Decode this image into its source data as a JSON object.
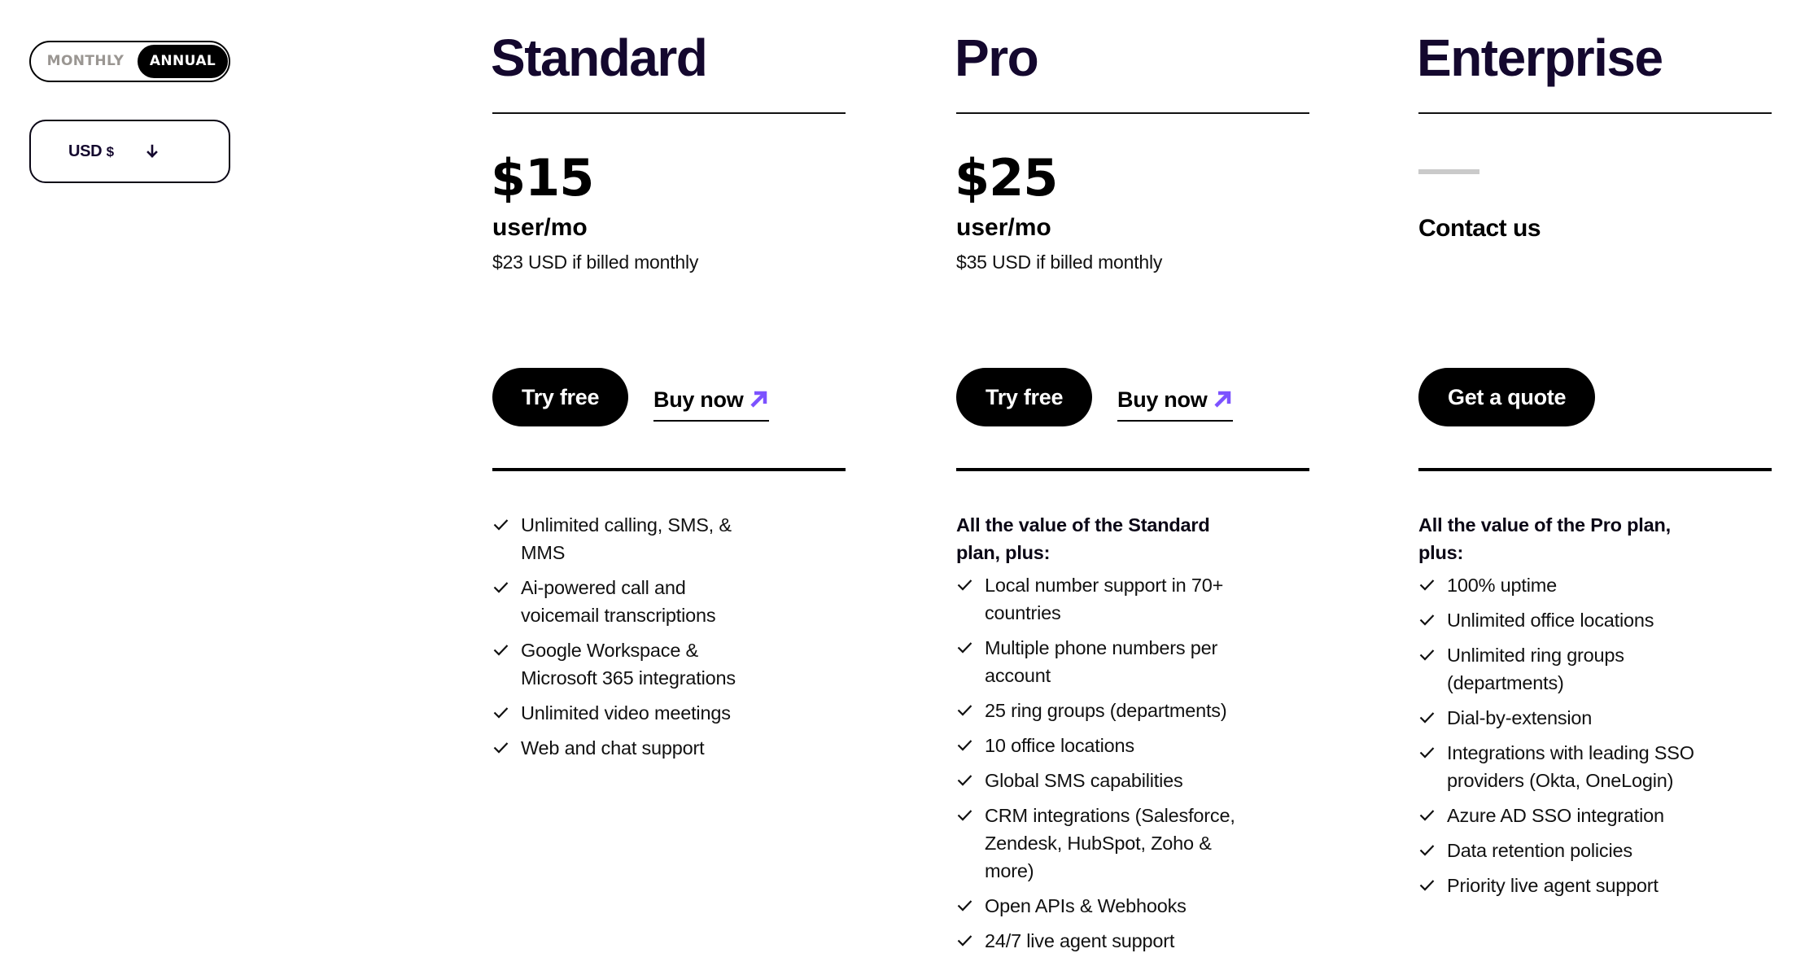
{
  "billing_toggle": {
    "options": [
      {
        "label": "MONTHLY",
        "active": false
      },
      {
        "label": "ANNUAL",
        "active": true
      }
    ]
  },
  "currency": {
    "code": "USD",
    "symbol": "$",
    "icon": "arrow-down-icon"
  },
  "accent_color": "#7c52ff",
  "plans": [
    {
      "name": "Standard",
      "price": "$15",
      "unit": "user/mo",
      "monthly_note": "$23 USD if billed monthly",
      "primary_button": "Try free",
      "secondary_link": "Buy now",
      "secondary_icon": "arrow-up-right-icon",
      "features_intro": "",
      "features": [
        "Unlimited calling, SMS, & MMS",
        "Ai-powered call and voicemail transcriptions",
        "Google Workspace & Microsoft 365 integrations",
        "Unlimited video meetings",
        "Web and chat support"
      ]
    },
    {
      "name": "Pro",
      "price": "$25",
      "unit": "user/mo",
      "monthly_note": "$35 USD if billed monthly",
      "primary_button": "Try free",
      "secondary_link": "Buy now",
      "secondary_icon": "arrow-up-right-icon",
      "features_intro": "All the value of the Standard plan, plus:",
      "features": [
        "Local number support in 70+ countries",
        "Multiple phone numbers per account",
        "25 ring groups (departments)",
        "10 office locations",
        "Global SMS capabilities",
        "CRM integrations (Salesforce, Zendesk, HubSpot, Zoho & more)",
        "Open APIs & Webhooks",
        "24/7 live agent support"
      ]
    },
    {
      "name": "Enterprise",
      "price_label": "Contact us",
      "primary_button": "Get a quote",
      "features_intro": "All the value of the Pro plan, plus:",
      "features": [
        "100% uptime",
        "Unlimited office locations",
        "Unlimited ring groups (departments)",
        "Dial-by-extension",
        "Integrations with leading SSO providers (Okta, OneLogin)",
        "Azure AD SSO integration",
        "Data retention policies",
        "Priority live agent support"
      ]
    }
  ]
}
